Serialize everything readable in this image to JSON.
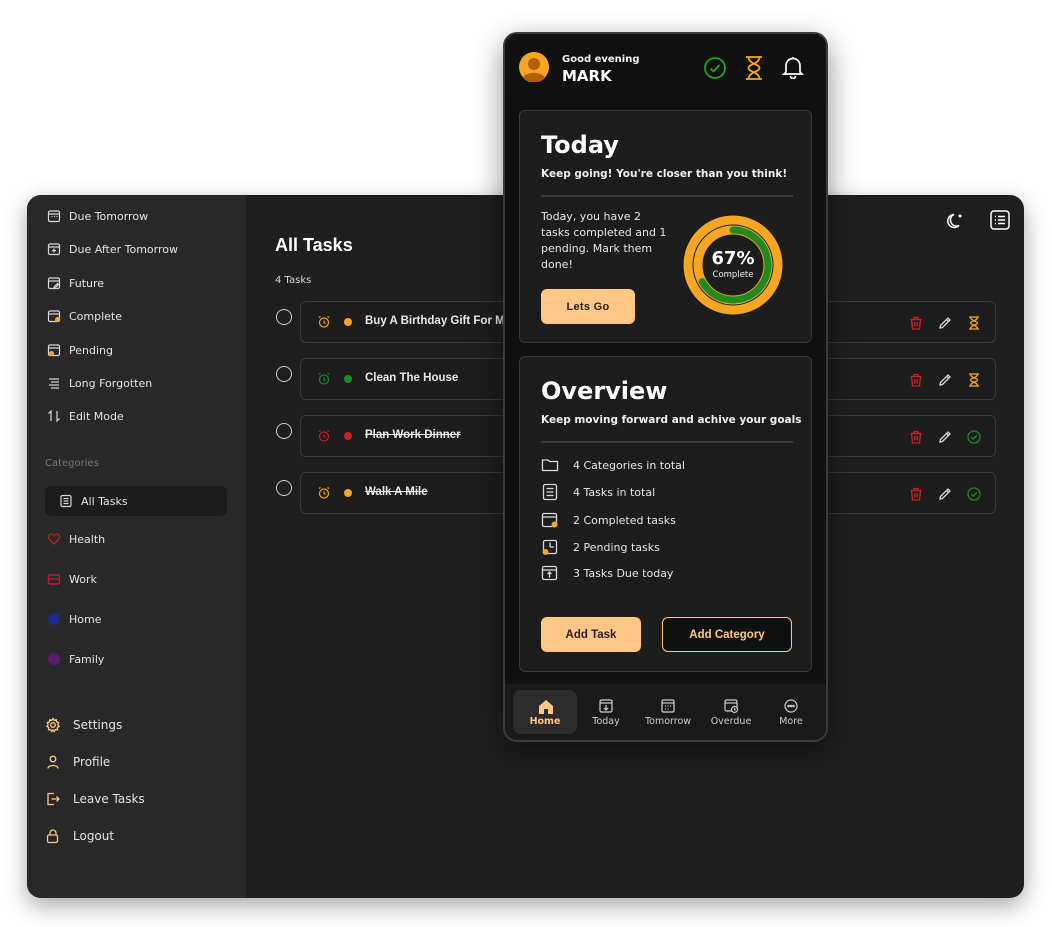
{
  "colors": {
    "accent": "#ffc785",
    "orange": "#f5a623",
    "green": "#1f8a1f",
    "red": "#d11f1f",
    "health": "#b32020",
    "work": "#c2183f",
    "home": "#1f2a8a",
    "family": "#5a1a6e"
  },
  "sidebar": {
    "nav": [
      {
        "label": "Due Tomorrow",
        "icon": "calendar-icon"
      },
      {
        "label": "Due After Tomorrow",
        "icon": "calendar-plus-icon"
      },
      {
        "label": "Future",
        "icon": "calendar-edit-icon"
      },
      {
        "label": "Complete",
        "icon": "calendar-check-icon"
      },
      {
        "label": "Pending",
        "icon": "calendar-clock-icon"
      },
      {
        "label": "Long Forgotten",
        "icon": "list-lines-icon"
      },
      {
        "label": "Edit Mode",
        "icon": "sort-arrows-icon"
      }
    ],
    "categories_heading": "Categories",
    "categories": [
      {
        "label": "All Tasks",
        "icon": "list-icon",
        "active": true
      },
      {
        "label": "Health",
        "icon": "heart-icon"
      },
      {
        "label": "Work",
        "icon": "briefcase-icon"
      },
      {
        "label": "Home",
        "icon": "house-icon"
      },
      {
        "label": "Family",
        "icon": "family-icon"
      }
    ],
    "bottom": [
      {
        "label": "Settings",
        "icon": "gear-icon"
      },
      {
        "label": "Profile",
        "icon": "person-icon"
      },
      {
        "label": "Leave Tasks",
        "icon": "exit-icon"
      },
      {
        "label": "Logout",
        "icon": "lock-icon"
      }
    ]
  },
  "main": {
    "title": "All Tasks",
    "count": "4 Tasks",
    "tasks": [
      {
        "title": "Buy A Birthday Gift For M",
        "status_color": "#f5a623",
        "completed": false,
        "state_icon": "hourglass-icon"
      },
      {
        "title": "Clean The House",
        "status_color": "#1f8a1f",
        "completed": false,
        "state_icon": "hourglass-icon"
      },
      {
        "title": "Plan Work Dinner",
        "status_color": "#d11f1f",
        "completed": true,
        "state_icon": "check-circle-icon"
      },
      {
        "title": "Walk A Mile",
        "status_color": "#f5a623",
        "completed": true,
        "state_icon": "check-circle-icon"
      }
    ]
  },
  "phone": {
    "greeting": "Good evening",
    "user_name": "MARK",
    "today": {
      "title": "Today",
      "subtitle": "Keep going! You're closer than you think!",
      "summary": "Today, you have 2 tasks completed and 1 pending. Mark them done!",
      "button": "Lets Go",
      "progress_value": 0.67,
      "progress_text": "67%",
      "progress_label": "Complete"
    },
    "overview": {
      "title": "Overview",
      "subtitle": "Keep moving forward and achive your goals",
      "items": [
        {
          "text": "4 Categories in total",
          "icon": "folder-icon"
        },
        {
          "text": "4 Tasks in total",
          "icon": "checklist-icon"
        },
        {
          "text": "2 Completed tasks",
          "icon": "calendar-check-icon"
        },
        {
          "text": "2 Pending tasks",
          "icon": "calendar-pending-icon"
        },
        {
          "text": "3 Tasks Due today",
          "icon": "calendar-upload-icon"
        }
      ],
      "add_task": "Add Task",
      "add_category": "Add Category"
    },
    "bottom_nav": [
      {
        "label": "Home",
        "icon": "home-icon",
        "active": true
      },
      {
        "label": "Today",
        "icon": "today-icon"
      },
      {
        "label": "Tomorrow",
        "icon": "calendar-grid-icon"
      },
      {
        "label": "Overdue",
        "icon": "calendar-clock-icon"
      },
      {
        "label": "More",
        "icon": "more-icon"
      }
    ]
  }
}
